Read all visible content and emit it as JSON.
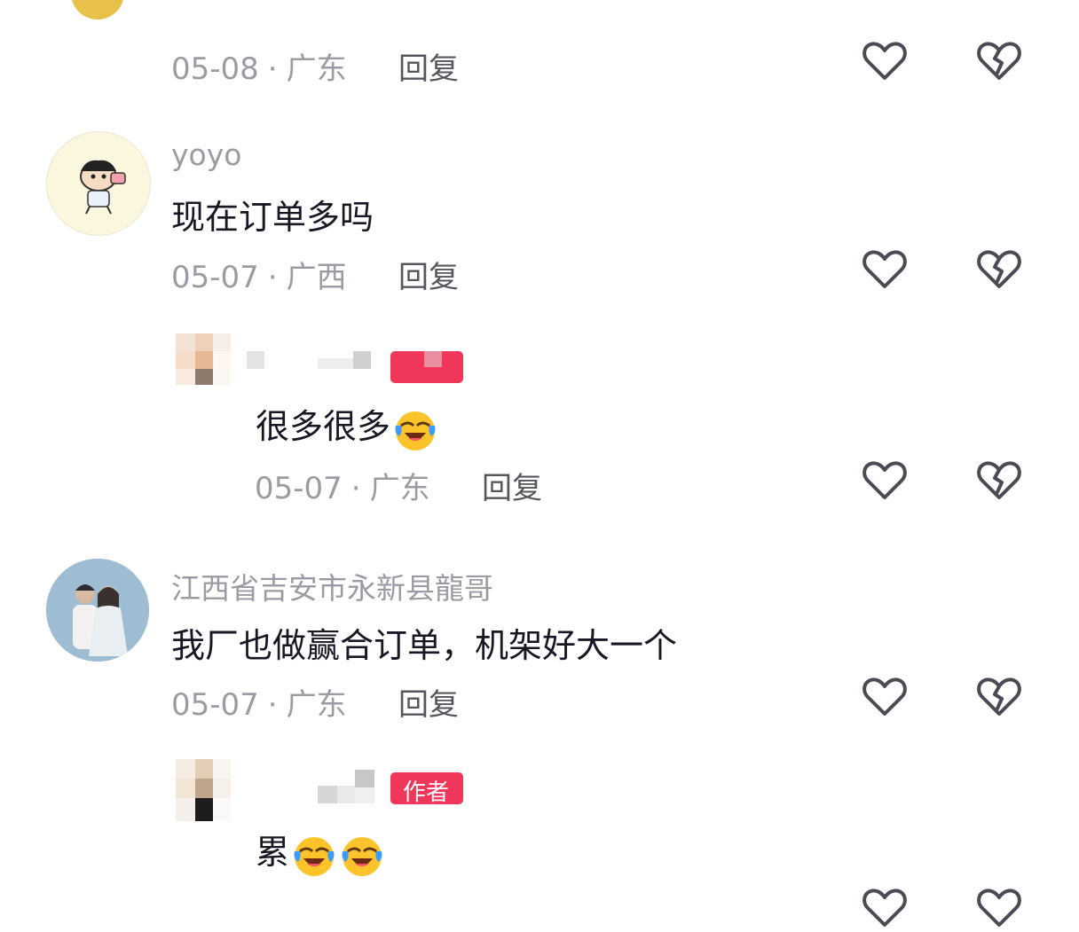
{
  "comments": [
    {
      "id": "c0",
      "date": "05-08",
      "region": "广东",
      "reply_label": "回复"
    },
    {
      "id": "c1",
      "username": "yoyo",
      "text": "现在订单多吗",
      "date": "05-07",
      "region": "广西",
      "reply_label": "回复",
      "avatar_icon": "cartoon-avatar"
    },
    {
      "id": "r1",
      "text": "很多很多",
      "emoji": "laughing-crying-emoji",
      "date": "05-07",
      "region": "广东",
      "reply_label": "回复"
    },
    {
      "id": "c2",
      "username": "江西省吉安市永新县龍哥",
      "text": "我厂也做赢合订单，机架好大一个",
      "date": "05-07",
      "region": "广东",
      "reply_label": "回复",
      "avatar_icon": "wedding-photo-avatar"
    },
    {
      "id": "r2",
      "text": "累",
      "emoji": "laughing-crying-emoji",
      "badge_label": "作者"
    }
  ],
  "icons": {
    "like": "heart-outline-icon",
    "dislike": "broken-heart-icon"
  },
  "colors": {
    "badge": "#f0365a",
    "meta": "#9a9ca3",
    "text": "#161823"
  }
}
